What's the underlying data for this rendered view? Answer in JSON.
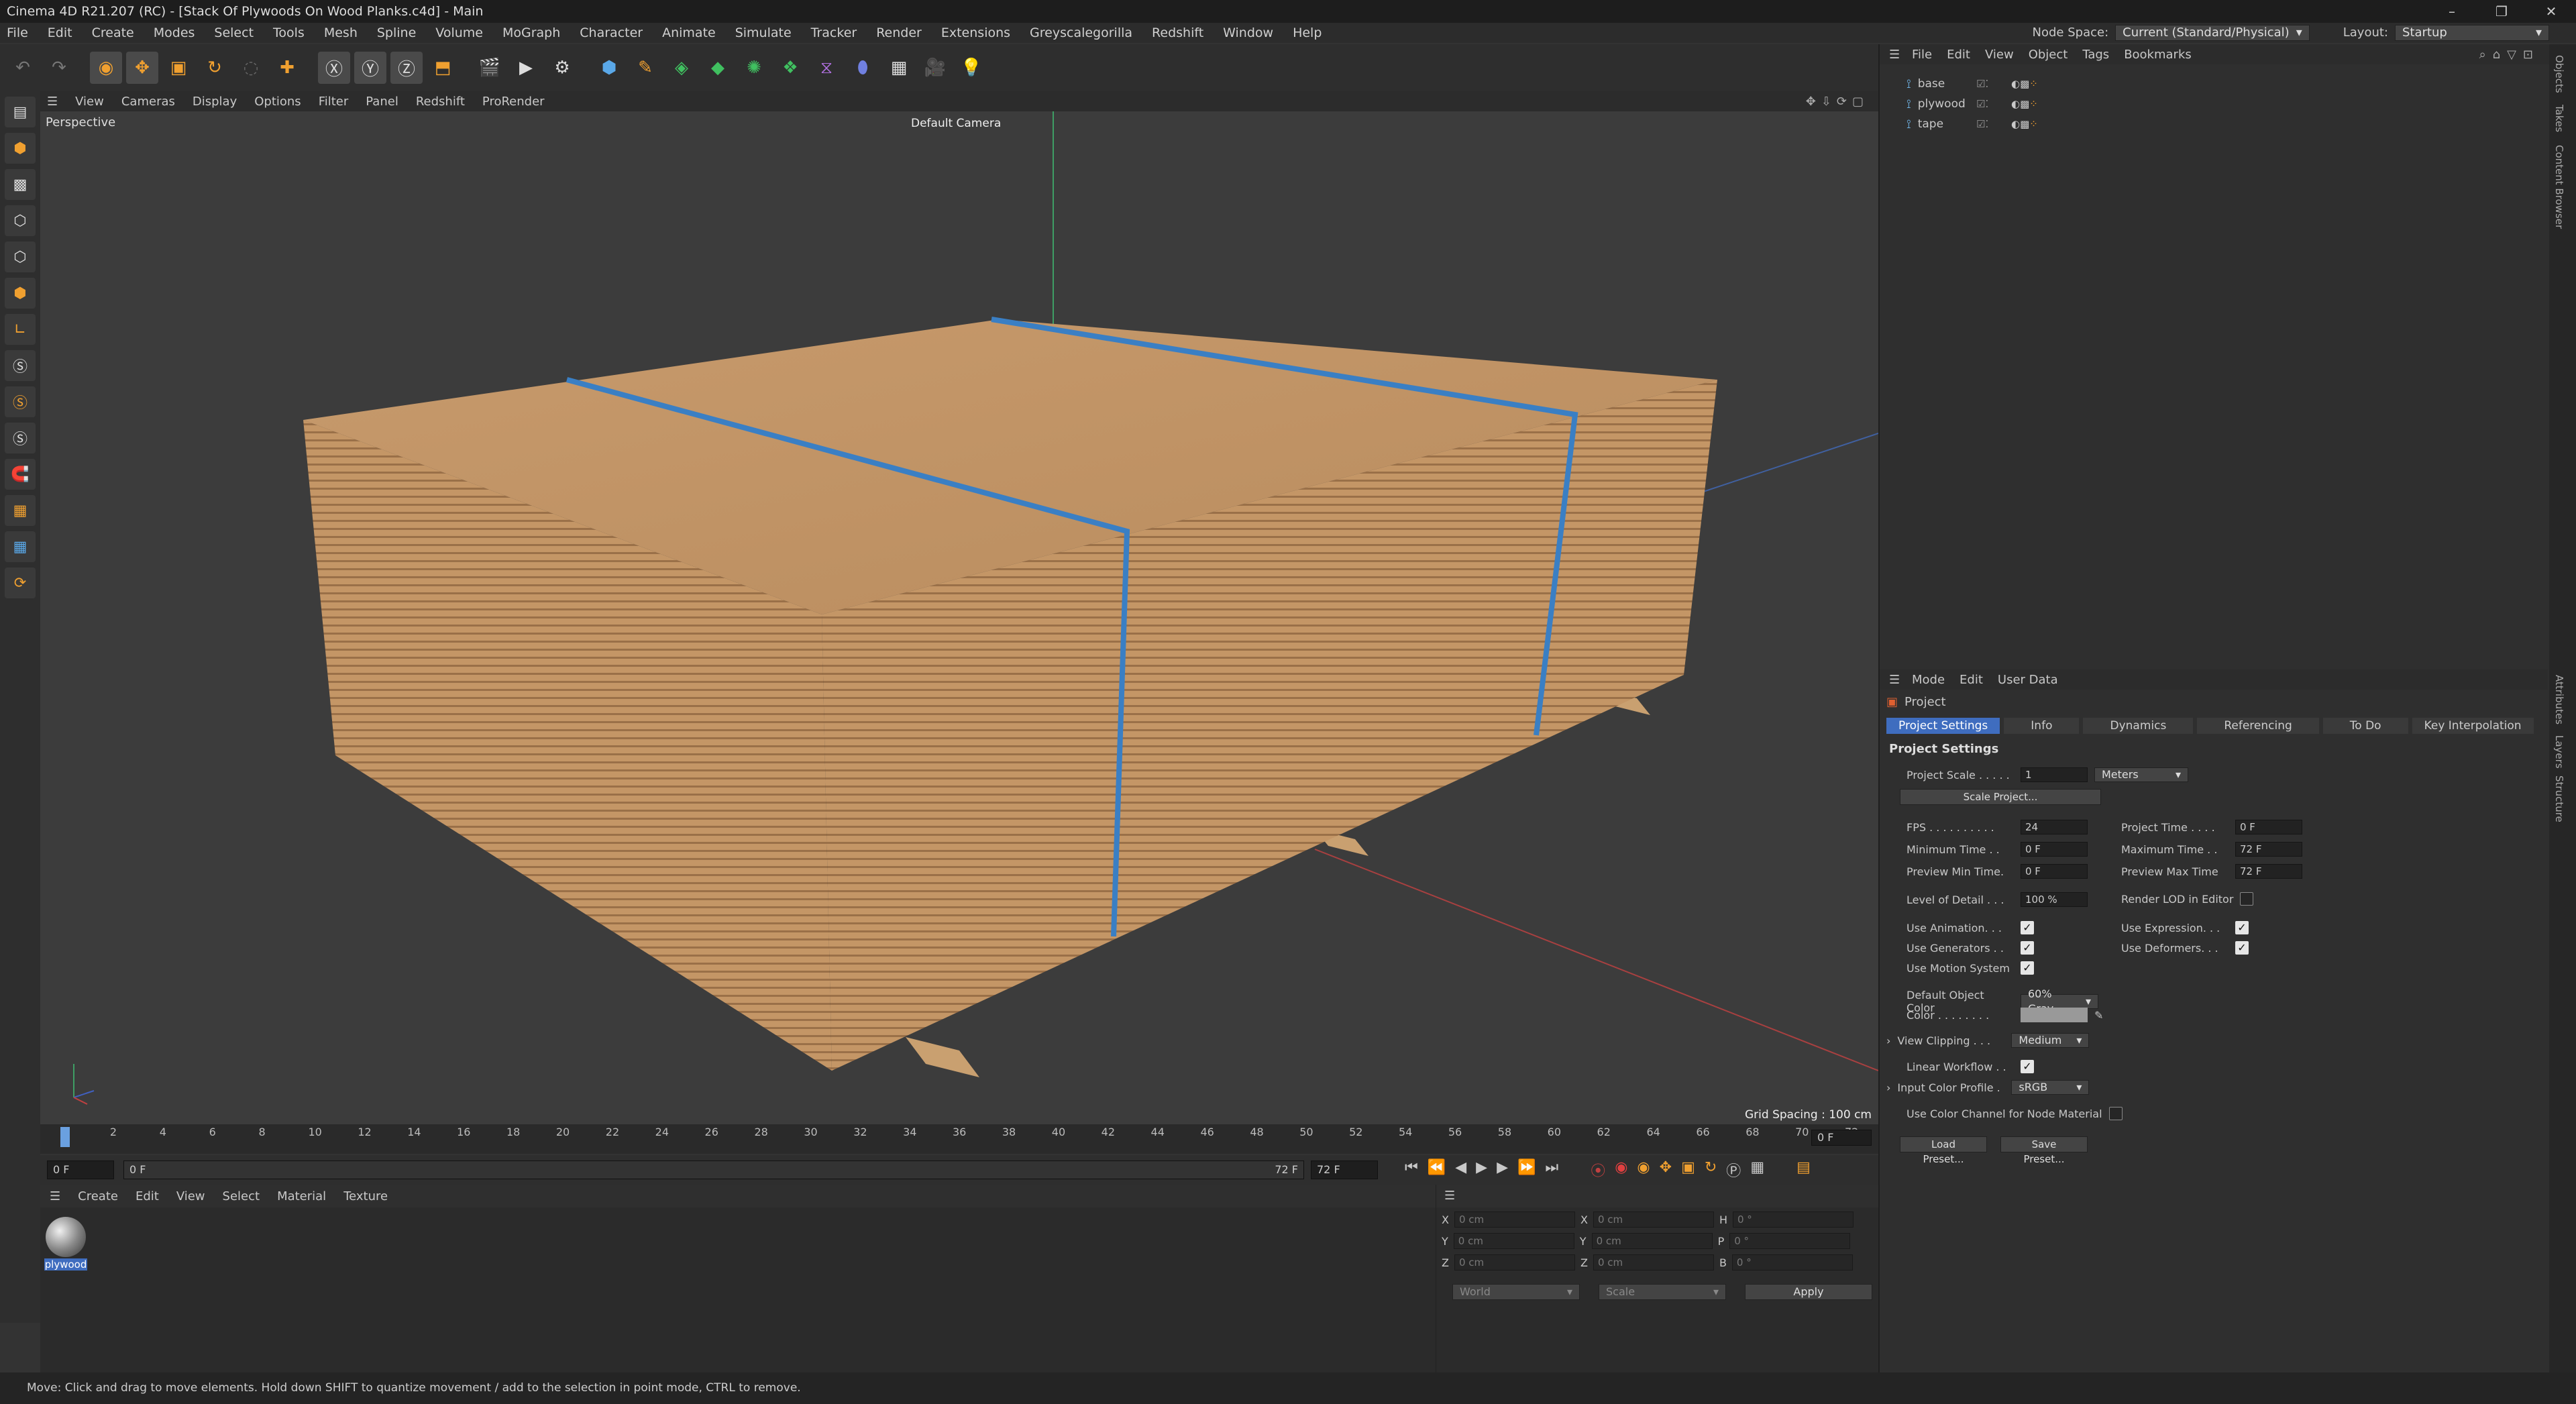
{
  "window": {
    "title": "Cinema 4D R21.207 (RC) - [Stack Of Plywoods On Wood Planks.c4d] - Main"
  },
  "menu": {
    "items": [
      "File",
      "Edit",
      "Create",
      "Modes",
      "Select",
      "Tools",
      "Mesh",
      "Spline",
      "Volume",
      "MoGraph",
      "Character",
      "Animate",
      "Simulate",
      "Tracker",
      "Render",
      "Extensions",
      "Greyscalegorilla",
      "Redshift",
      "Window",
      "Help"
    ],
    "node_space_label": "Node Space:",
    "node_space_value": "Current (Standard/Physical)",
    "layout_label": "Layout:",
    "layout_value": "Startup"
  },
  "toolbar": {
    "icons": [
      "undo-icon",
      "redo-icon",
      "live-selection-icon",
      "move-icon",
      "scale-icon",
      "rotate-icon",
      "recent-tool-icon",
      "add-icon",
      "x-axis-icon",
      "y-axis-icon",
      "z-axis-icon",
      "world-coords-icon",
      "render-region-icon",
      "render-view-icon",
      "render-settings-icon",
      "cube-icon",
      "pen-icon",
      "subdivision-icon",
      "extrude-icon",
      "cloner-icon",
      "mograph-icon",
      "deformer-icon",
      "field-icon",
      "floor-icon",
      "camera-icon",
      "light-icon"
    ]
  },
  "viewport": {
    "menu": [
      "View",
      "Cameras",
      "Display",
      "Options",
      "Filter",
      "Panel",
      "Redshift",
      "ProRender"
    ],
    "label": "Perspective",
    "camera": "Default Camera",
    "grid_spacing": "Grid Spacing : 100 cm"
  },
  "timeline": {
    "ticks": [
      "0",
      "2",
      "4",
      "6",
      "8",
      "10",
      "12",
      "14",
      "16",
      "18",
      "20",
      "22",
      "24",
      "26",
      "28",
      "30",
      "32",
      "34",
      "36",
      "38",
      "40",
      "42",
      "44",
      "46",
      "48",
      "50",
      "52",
      "54",
      "56",
      "58",
      "60",
      "62",
      "64",
      "66",
      "68",
      "70",
      "72"
    ],
    "current_frame": "0 F"
  },
  "transport": {
    "start": "0 F",
    "start2": "0 F",
    "end": "72 F",
    "end2": "72 F"
  },
  "material_panel": {
    "menu": [
      "Create",
      "Edit",
      "View",
      "Select",
      "Material",
      "Texture"
    ],
    "material_name": "plywood"
  },
  "coords": {
    "rows": [
      {
        "a": "X",
        "av": "0 cm",
        "b": "X",
        "bv": "0 cm",
        "c": "H",
        "cv": "0 °"
      },
      {
        "a": "Y",
        "av": "0 cm",
        "b": "Y",
        "bv": "0 cm",
        "c": "P",
        "cv": "0 °"
      },
      {
        "a": "Z",
        "av": "0 cm",
        "b": "Z",
        "bv": "0 cm",
        "c": "B",
        "cv": "0 °"
      }
    ],
    "mode1": "World",
    "mode2": "Scale",
    "apply": "Apply"
  },
  "status": "Move: Click and drag to move elements. Hold down SHIFT to quantize movement / add to the selection in point mode, CTRL to remove.",
  "object_manager": {
    "menu": [
      "File",
      "Edit",
      "View",
      "Object",
      "Tags",
      "Bookmarks"
    ],
    "objects": [
      "base",
      "plywood",
      "tape"
    ]
  },
  "attributes": {
    "menu": [
      "Mode",
      "Edit",
      "User Data"
    ],
    "project": "Project",
    "tabs": [
      "Project Settings",
      "Info",
      "Dynamics",
      "Referencing",
      "To Do",
      "Key Interpolation"
    ],
    "section": "Project Settings",
    "project_scale_label": "Project Scale . . . . .",
    "project_scale": "1",
    "project_scale_unit": "Meters",
    "scale_project": "Scale Project...",
    "fps_label": "FPS . . . . . . . . . .",
    "fps": "24",
    "project_time_label": "Project Time . . . .",
    "project_time": "0 F",
    "min_time_label": "Minimum Time . .",
    "min_time": "0 F",
    "max_time_label": "Maximum Time . .",
    "max_time": "72 F",
    "prev_min_label": "Preview Min Time.",
    "prev_min": "0 F",
    "prev_max_label": "Preview Max Time",
    "prev_max": "72 F",
    "lod_label": "Level of Detail . . .",
    "lod": "100 %",
    "render_lod_label": "Render LOD in Editor",
    "use_anim": "Use Animation. . .",
    "use_expr": "Use Expression. . .",
    "use_gen": "Use Generators . .",
    "use_def": "Use Deformers. . .",
    "use_motion": "Use Motion System",
    "def_color_label": "Default Object Color",
    "def_color": "60% Gray",
    "color_label": "Color . . . . . . . .",
    "view_clip_label": "View Clipping . . .",
    "view_clip": "Medium",
    "linear_label": "Linear Workflow . .",
    "icp_label": "Input Color Profile .",
    "icp": "sRGB",
    "ucc_label": "Use Color Channel for Node Material",
    "load_preset": "Load Preset...",
    "save_preset": "Save Preset..."
  },
  "side_tabs": [
    "Objects",
    "Takes",
    "Content Browser",
    "Attributes",
    "Layers",
    "Structure"
  ],
  "colors": {
    "accent": "#3f6dbf",
    "tape": "#3a7fc4",
    "plywood": "#c89c6c"
  }
}
